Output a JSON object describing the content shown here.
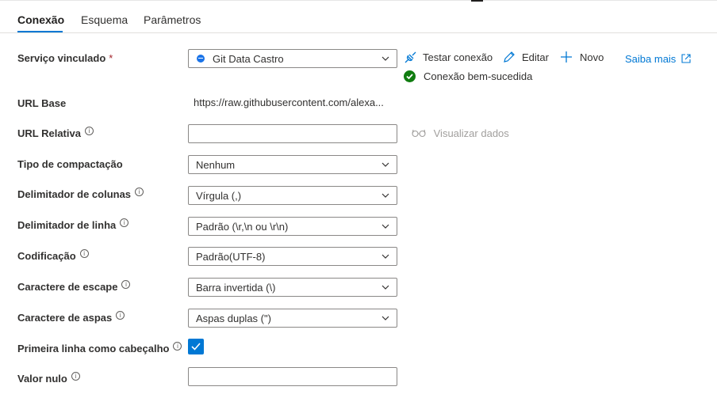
{
  "tabs": [
    {
      "label": "Conexão",
      "active": true
    },
    {
      "label": "Esquema",
      "active": false
    },
    {
      "label": "Parâmetros",
      "active": false
    }
  ],
  "linked_service": {
    "label": "Serviço vinculado",
    "required_mark": "*",
    "value": "Git Data Castro",
    "icon": "globe-icon",
    "actions": {
      "test_connection": "Testar conexão",
      "edit": "Editar",
      "new": "Novo",
      "learn_more": "Saiba mais"
    },
    "status": "Conexão bem-sucedida"
  },
  "base_url": {
    "label": "URL Base",
    "value": "https://raw.githubusercontent.com/alexa..."
  },
  "relative_url": {
    "label": "URL Relativa",
    "value": "",
    "preview_label": "Visualizar dados"
  },
  "compression": {
    "label": "Tipo de compactação",
    "value": "Nenhum"
  },
  "column_delimiter": {
    "label": "Delimitador de colunas",
    "value": "Vírgula (,)"
  },
  "row_delimiter": {
    "label": "Delimitador de linha",
    "value": "Padrão (\\r,\\n ou \\r\\n)"
  },
  "encoding": {
    "label": "Codificação",
    "value": "Padrão(UTF-8)"
  },
  "escape_char": {
    "label": "Caractere de escape",
    "value": "Barra invertida (\\)"
  },
  "quote_char": {
    "label": "Caractere de aspas",
    "value": "Aspas duplas (\")"
  },
  "first_row_header": {
    "label": "Primeira linha como cabeçalho",
    "checked": true
  },
  "null_value": {
    "label": "Valor nulo",
    "value": ""
  },
  "info_glyph": "i",
  "colors": {
    "accent": "#0078d4",
    "success": "#107c10",
    "required": "#a4262c"
  }
}
